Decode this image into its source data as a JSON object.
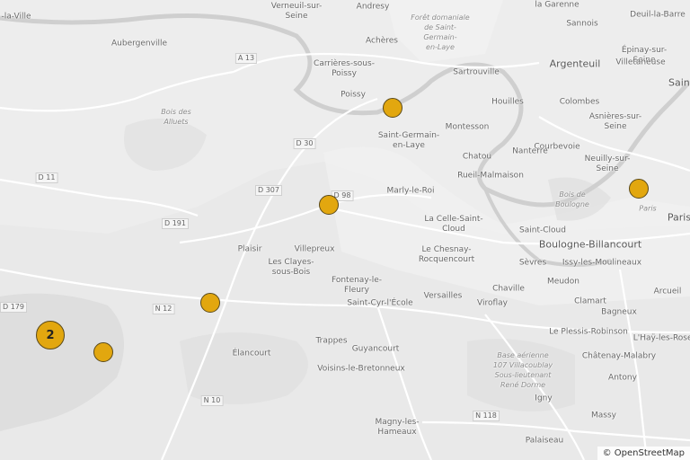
{
  "labels": [
    {
      "text": "Verneuil-sur-\nSeine",
      "cls": ""
    },
    {
      "text": "Andresy",
      "cls": ""
    },
    {
      "text": "Forêt domaniale\nde Saint-\nGermain-\nen-Laye",
      "cls": "forest"
    },
    {
      "text": "la Garenne",
      "cls": ""
    },
    {
      "text": "Sannois",
      "cls": ""
    },
    {
      "text": "Deuil-la-Barre",
      "cls": ""
    },
    {
      "text": "-la-Ville",
      "cls": ""
    },
    {
      "text": "Aubergenville",
      "cls": ""
    },
    {
      "text": "Achères",
      "cls": ""
    },
    {
      "text": "Argenteuil",
      "cls": "big"
    },
    {
      "text": "Épinay-sur-\nSeine",
      "cls": ""
    },
    {
      "text": "Villetaneuse",
      "cls": ""
    },
    {
      "text": "Carrières-sous-\nPoissy",
      "cls": ""
    },
    {
      "text": "Sartrouville",
      "cls": ""
    },
    {
      "text": "Saint-",
      "cls": "big"
    },
    {
      "text": "Poissy",
      "cls": ""
    },
    {
      "text": "Houilles",
      "cls": ""
    },
    {
      "text": "Colombes",
      "cls": ""
    },
    {
      "text": "Bois des\nAlluets",
      "cls": "forest"
    },
    {
      "text": "Montesson",
      "cls": ""
    },
    {
      "text": "Asnières-sur-\nSeine",
      "cls": ""
    },
    {
      "text": "Saint-Germain-\nen-Laye",
      "cls": ""
    },
    {
      "text": "Courbevoie",
      "cls": ""
    },
    {
      "text": "Chatou",
      "cls": ""
    },
    {
      "text": "Nanterre",
      "cls": ""
    },
    {
      "text": "Neuilly-sur-\nSeine",
      "cls": ""
    },
    {
      "text": "Rueil-Malmaison",
      "cls": ""
    },
    {
      "text": "Marly-le-Roi",
      "cls": ""
    },
    {
      "text": "Bois de\nBoulogne",
      "cls": "forest"
    },
    {
      "text": "Paris",
      "cls": "forest"
    },
    {
      "text": "Paris",
      "cls": "big"
    },
    {
      "text": "La Celle-Saint-\nCloud",
      "cls": ""
    },
    {
      "text": "Saint-Cloud",
      "cls": ""
    },
    {
      "text": "Villepreux",
      "cls": ""
    },
    {
      "text": "Le Chesnay-\nRocquencourt",
      "cls": ""
    },
    {
      "text": "Boulogne-Billancourt",
      "cls": "big"
    },
    {
      "text": "Plaisir",
      "cls": ""
    },
    {
      "text": "Les Clayes-\nsous-Bois",
      "cls": ""
    },
    {
      "text": "Sèvres",
      "cls": ""
    },
    {
      "text": "Issy-les-Moulineaux",
      "cls": ""
    },
    {
      "text": "Fontenay-le-\nFleury",
      "cls": ""
    },
    {
      "text": "Versailles",
      "cls": ""
    },
    {
      "text": "Chaville",
      "cls": ""
    },
    {
      "text": "Meudon",
      "cls": ""
    },
    {
      "text": "Arcueil",
      "cls": ""
    },
    {
      "text": "Saint-Cyr-l'École",
      "cls": ""
    },
    {
      "text": "Viroflay",
      "cls": ""
    },
    {
      "text": "Clamart",
      "cls": ""
    },
    {
      "text": "Bagneux",
      "cls": ""
    },
    {
      "text": "Trappes",
      "cls": ""
    },
    {
      "text": "Le Plessis-Robinson",
      "cls": ""
    },
    {
      "text": "L'Haÿ-les-Roses",
      "cls": ""
    },
    {
      "text": "Élancourt",
      "cls": ""
    },
    {
      "text": "Guyancourt",
      "cls": ""
    },
    {
      "text": "Base aérienne\n107 Villacoublay\nSous-lieutenant\nRené Dorme",
      "cls": "forest"
    },
    {
      "text": "Châtenay-Malabry",
      "cls": ""
    },
    {
      "text": "Voisins-le-Bretonneux",
      "cls": ""
    },
    {
      "text": "Antony",
      "cls": ""
    },
    {
      "text": "Igny",
      "cls": ""
    },
    {
      "text": "Massy",
      "cls": ""
    },
    {
      "text": "Magny-les-\nHameaux",
      "cls": ""
    },
    {
      "text": "Palaiseau",
      "cls": ""
    }
  ],
  "roads": [
    "A 13",
    "D 30",
    "D 307",
    "D 98",
    "D 11",
    "D 191",
    "D 179",
    "N 12",
    "N 10",
    "N 118"
  ],
  "markers": [
    {
      "kind": "single",
      "count": ""
    },
    {
      "kind": "single",
      "count": ""
    },
    {
      "kind": "single",
      "count": ""
    },
    {
      "kind": "single",
      "count": ""
    },
    {
      "kind": "cluster",
      "count": "2"
    },
    {
      "kind": "single",
      "count": ""
    }
  ],
  "attribution": "© OpenStreetMap",
  "colors": {
    "marker": "#e2a70f",
    "marker_border": "#5b4a1a",
    "water": "#d4d4d4",
    "road": "#ffffff",
    "land": "#e9e9e9"
  }
}
